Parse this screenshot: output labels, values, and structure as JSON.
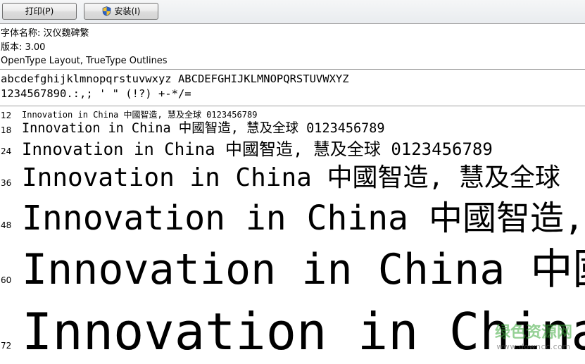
{
  "toolbar": {
    "print_label": "打印(P)",
    "install_label": "安装(I)"
  },
  "font_info": {
    "name_line": "字体名称: 汉仪魏碑繁",
    "version_line": "版本: 3.00",
    "type_line": "OpenType Layout, TrueType Outlines"
  },
  "charset": {
    "line1": "abcdefghijklmnopqrstuvwxyz ABCDEFGHIJKLMNOPQRSTUVWXYZ",
    "line2": "1234567890.:,; ' \" (!?) +-*/="
  },
  "samples": [
    {
      "size": "12",
      "text": "Innovation in China 中國智造, 慧及全球 0123456789"
    },
    {
      "size": "18",
      "text": "Innovation in China 中國智造, 慧及全球 0123456789"
    },
    {
      "size": "24",
      "text": "Innovation in China 中國智造, 慧及全球 0123456789"
    },
    {
      "size": "36",
      "text": "Innovation in China 中國智造, 慧及全球"
    },
    {
      "size": "48",
      "text": "Innovation in China 中國智造,"
    },
    {
      "size": "60",
      "text": "Innovation in China 中國"
    },
    {
      "size": "72",
      "text": "Innovation in China"
    }
  ],
  "watermark": {
    "text": "绿色资源网",
    "url": "www.downcc.com"
  },
  "colors": {
    "watermark": "#3caa3c",
    "divider": "#a0a0a0"
  }
}
